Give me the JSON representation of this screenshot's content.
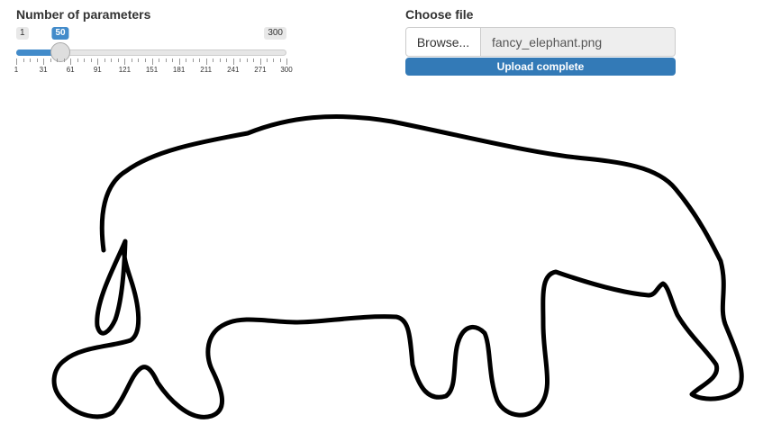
{
  "slider": {
    "label": "Number of parameters",
    "min": 1,
    "max": 300,
    "value": 50,
    "min_label": "1",
    "max_label": "300",
    "value_label": "50",
    "tick_labels": [
      "1",
      "31",
      "61",
      "91",
      "121",
      "151",
      "181",
      "211",
      "241",
      "271",
      "300"
    ],
    "accent": "#428bca"
  },
  "file_input": {
    "label": "Choose file",
    "button_label": "Browse...",
    "file_name": "fancy_elephant.png",
    "progress_text": "Upload complete",
    "progress": 1.0,
    "progress_color": "#337ab7"
  },
  "plot": {
    "description_icon": "elephant-outline",
    "stroke_color": "#000000"
  }
}
